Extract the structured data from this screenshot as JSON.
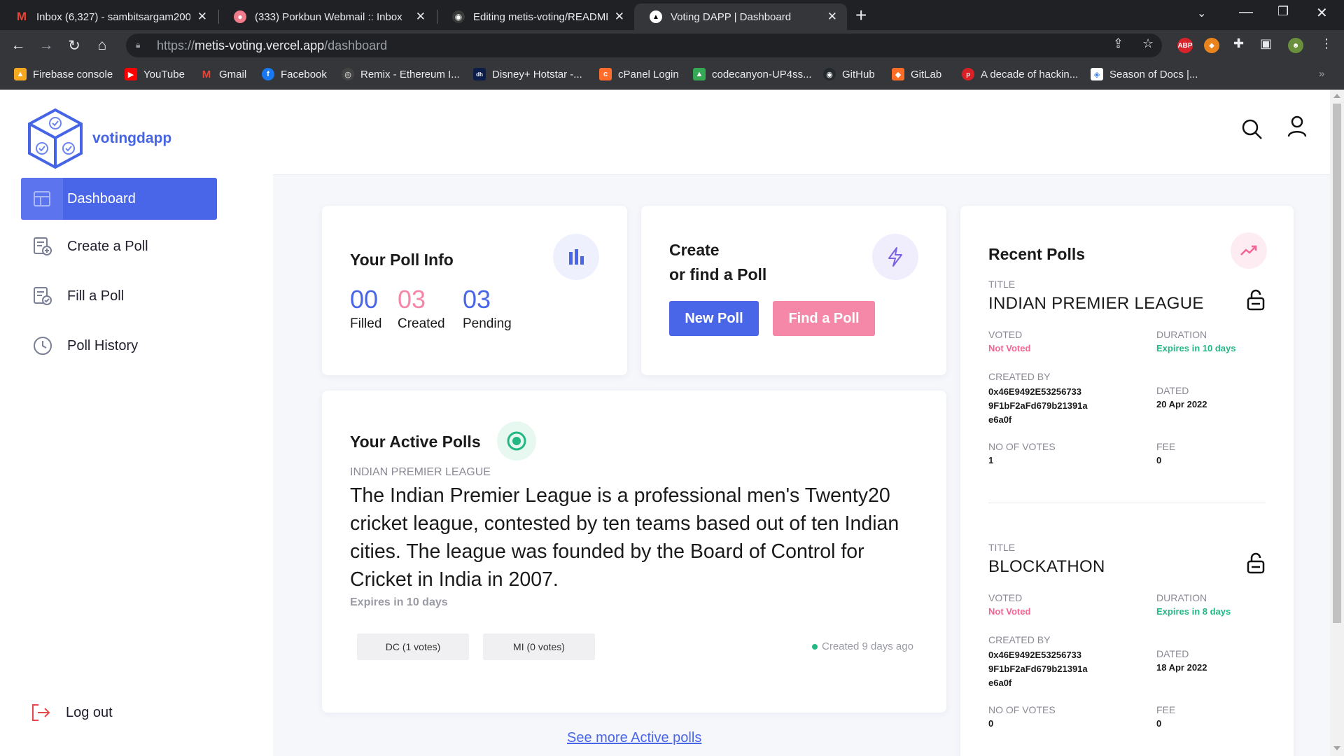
{
  "browser": {
    "tabs": [
      {
        "title": "Inbox (6,327) - sambitsargam200",
        "icon": "gmail-icon"
      },
      {
        "title": "(333) Porkbun Webmail :: Inbox",
        "icon": "porkbun-icon"
      },
      {
        "title": "Editing metis-voting/README.m",
        "icon": "github-icon"
      },
      {
        "title": "Voting DAPP | Dashboard",
        "icon": "vercel-icon"
      }
    ],
    "url": {
      "scheme": "https://",
      "host": "metis-voting.vercel.app",
      "path": "/dashboard"
    },
    "bookmarks": [
      {
        "label": "Firebase console",
        "icon": "firebase-icon",
        "color": "#f6a821"
      },
      {
        "label": "YouTube",
        "icon": "youtube-icon",
        "color": "#ff0000"
      },
      {
        "label": "Gmail",
        "icon": "gmail-icon",
        "color": "#ea4335"
      },
      {
        "label": "Facebook",
        "icon": "facebook-icon",
        "color": "#1877f2"
      },
      {
        "label": "Remix - Ethereum I...",
        "icon": "remix-icon",
        "color": "#444444"
      },
      {
        "label": "Disney+ Hotstar -...",
        "icon": "hotstar-icon",
        "color": "#0c1d4a"
      },
      {
        "label": "cPanel Login",
        "icon": "cpanel-icon",
        "color": "#ff6c2c"
      },
      {
        "label": "codecanyon-UP4ss...",
        "icon": "drive-icon",
        "color": "#34a853"
      },
      {
        "label": "GitHub",
        "icon": "github-icon",
        "color": "#24292e"
      },
      {
        "label": "GitLab",
        "icon": "gitlab-icon",
        "color": "#fc6d26"
      },
      {
        "label": "A decade of hackin...",
        "icon": "blog-icon",
        "color": "#d92027"
      },
      {
        "label": "Season of Docs |...",
        "icon": "google-icon",
        "color": "#4285f4"
      }
    ]
  },
  "app": {
    "logo_text": "votingdapp",
    "nav": [
      {
        "label": "Dashboard",
        "icon": "dashboard-icon"
      },
      {
        "label": "Create a Poll",
        "icon": "create-poll-icon"
      },
      {
        "label": "Fill a Poll",
        "icon": "fill-poll-icon"
      },
      {
        "label": "Poll History",
        "icon": "history-icon"
      }
    ],
    "logout_label": "Log out",
    "colors": {
      "primary": "#4a66e8",
      "pink": "#f587a8",
      "green": "#22b883",
      "red": "#f36593"
    }
  },
  "poll_info": {
    "title": "Your Poll Info",
    "stats": [
      {
        "value": "00",
        "label": "Filled",
        "color": "#4a66e8"
      },
      {
        "value": "03",
        "label": "Created",
        "color": "#f36593"
      },
      {
        "value": "03",
        "label": "Pending",
        "color": "#4a66e8"
      }
    ]
  },
  "create_card": {
    "title_line1": "Create",
    "title_line2": "or find a Poll",
    "new_poll_label": "New Poll",
    "find_poll_label": "Find a Poll"
  },
  "active_polls": {
    "title": "Your Active Polls",
    "poll_name": "INDIAN PREMIER LEAGUE",
    "description": "The Indian Premier League is a professional men's Twenty20 cricket league, contested by ten teams based out of ten Indian cities. The league was founded by the Board of Control for Cricket in India in 2007.",
    "expires": "Expires in 10 days",
    "options": [
      "DC (1 votes)",
      "MI (0 votes)"
    ],
    "created": "Created 9 days ago",
    "see_more": "See more Active polls"
  },
  "recent_polls": {
    "title": "Recent Polls",
    "labels": {
      "title": "TITLE",
      "voted": "VOTED",
      "duration": "DURATION",
      "created_by": "CREATED BY",
      "dated": "DATED",
      "votes": "NO OF VOTES",
      "fee": "FEE"
    },
    "items": [
      {
        "title": "INDIAN PREMIER LEAGUE",
        "voted": "Not Voted",
        "duration": "Expires in 10 days",
        "created_by_1": "0x46E9492E53256733",
        "created_by_2": "9F1bF2aFd679b21391a",
        "created_by_3": "e6a0f",
        "dated": "20 Apr 2022",
        "votes": "1",
        "fee": "0"
      },
      {
        "title": "BLOCKATHON",
        "voted": "Not Voted",
        "duration": "Expires in 8 days",
        "created_by_1": "0x46E9492E53256733",
        "created_by_2": "9F1bF2aFd679b21391a",
        "created_by_3": "e6a0f",
        "dated": "18 Apr 2022",
        "votes": "0",
        "fee": "0"
      }
    ]
  }
}
